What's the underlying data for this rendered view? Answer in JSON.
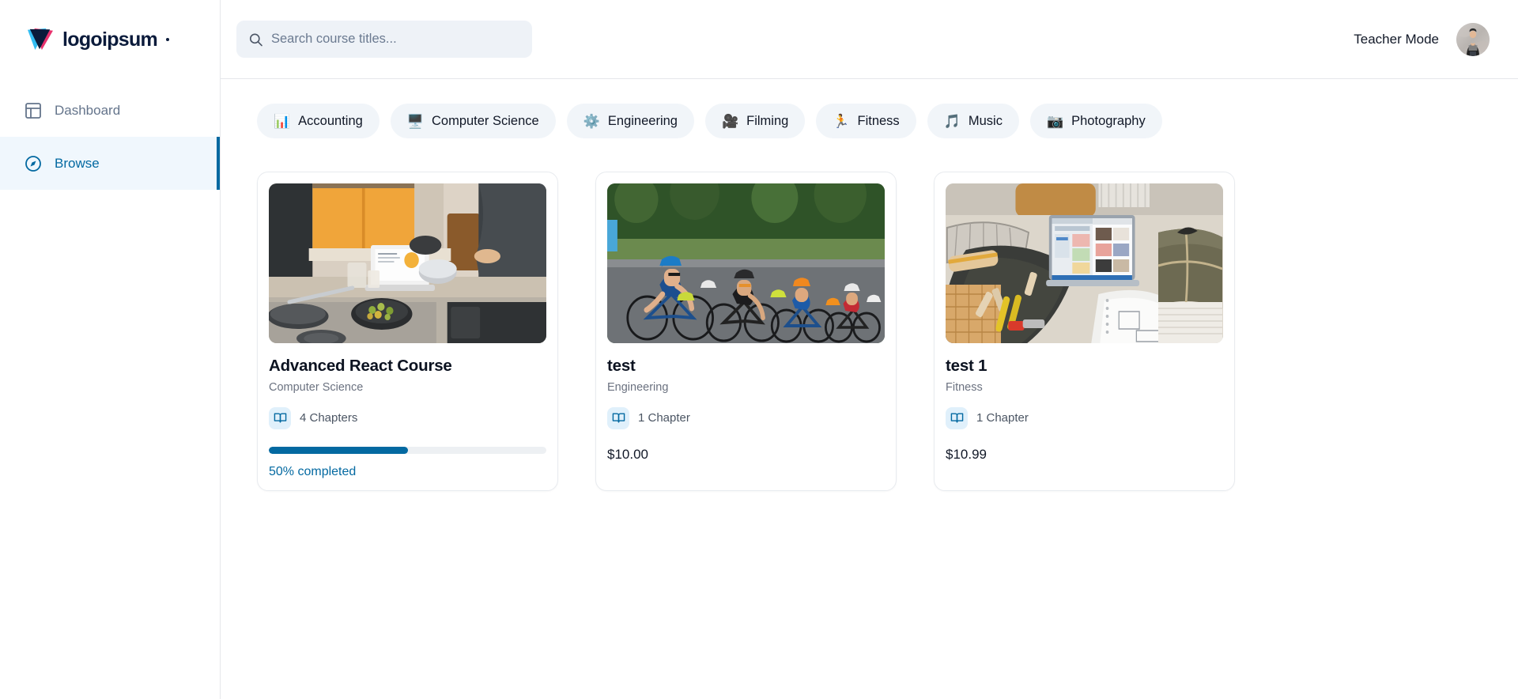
{
  "brand": {
    "name": "logoipsum",
    "mark_icon": "logo-triangle-mark",
    "accent_dark": "#0b1b3b",
    "accent_pink": "#e8326d",
    "accent_cyan": "#33bdf2"
  },
  "sidebar": {
    "items": [
      {
        "label": "Dashboard",
        "icon": "layout-dashboard-icon",
        "active": false
      },
      {
        "label": "Browse",
        "icon": "compass-icon",
        "active": true
      }
    ],
    "active_color": "#0369a1",
    "active_bg": "#f0f7fd"
  },
  "topbar": {
    "search": {
      "placeholder": "Search course titles...",
      "value": "",
      "icon": "search-icon"
    },
    "teacher_mode_label": "Teacher Mode",
    "avatar_icon": "user-avatar"
  },
  "categories": [
    {
      "label": "Accounting",
      "emoji": "📊",
      "icon": "bar-chart-icon"
    },
    {
      "label": "Computer Science",
      "emoji": "🖥️",
      "icon": "computer-icon"
    },
    {
      "label": "Engineering",
      "emoji": "⚙️",
      "icon": "gear-icon"
    },
    {
      "label": "Filming",
      "emoji": "🎥",
      "icon": "film-camera-icon"
    },
    {
      "label": "Fitness",
      "emoji": "🏃",
      "icon": "runner-icon"
    },
    {
      "label": "Music",
      "emoji": "🎵",
      "icon": "music-note-icon"
    },
    {
      "label": "Photography",
      "emoji": "📷",
      "icon": "camera-icon"
    }
  ],
  "courses": [
    {
      "title": "Advanced React Course",
      "category": "Computer Science",
      "chapters_label": "4 Chapters",
      "image_name": "kitchen-laptop-cooking-photo",
      "progress_percent": 50,
      "progress_label": "50% completed",
      "price": null,
      "has_progress": true
    },
    {
      "title": "test",
      "category": "Engineering",
      "chapters_label": "1 Chapter",
      "image_name": "cyclists-race-photo",
      "progress_percent": null,
      "progress_label": null,
      "price": "$10.00",
      "has_progress": false
    },
    {
      "title": "test 1",
      "category": "Fitness",
      "chapters_label": "1 Chapter",
      "image_name": "workbench-laptop-design-photo",
      "progress_percent": null,
      "progress_label": null,
      "price": "$10.99",
      "has_progress": false
    }
  ]
}
